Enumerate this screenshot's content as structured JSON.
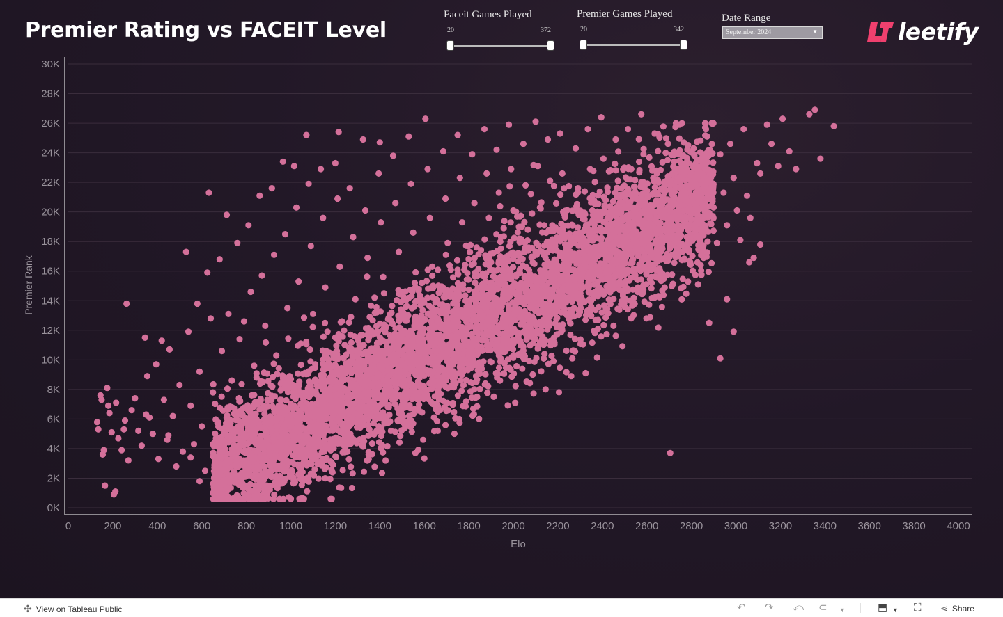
{
  "title": "Premier Rating vs FACEIT Level",
  "filters": {
    "faceit": {
      "label": "Faceit Games Played",
      "min": "20",
      "max": "372",
      "low": 0,
      "high": 1
    },
    "premier": {
      "label": "Premier Games Played",
      "min": "20",
      "max": "342",
      "low": 0,
      "high": 1
    },
    "date": {
      "label": "Date Range",
      "value": "September 2024"
    }
  },
  "logo_text": "leetify",
  "colors": {
    "point": "#d4709a",
    "grid": "#3a2d3c",
    "axis": "#ffffff",
    "tick": "#9a939c"
  },
  "footer": {
    "view_link": "View on Tableau Public",
    "share": "Share",
    "icons": [
      "tableau-icon",
      "undo-icon",
      "redo-icon",
      "revert-icon",
      "refresh-icon",
      "pause-icon",
      "download-icon",
      "fullscreen-icon",
      "share-icon"
    ]
  },
  "chart_data": {
    "type": "scatter",
    "xlabel": "Elo",
    "ylabel": "Premier Rank",
    "xlim": [
      0,
      4000
    ],
    "ylim": [
      0,
      30000
    ],
    "x_ticks": [
      "0",
      "200",
      "400",
      "600",
      "800",
      "1000",
      "1200",
      "1400",
      "1600",
      "1800",
      "2000",
      "2200",
      "2400",
      "2600",
      "2800",
      "3000",
      "3200",
      "3400",
      "3600",
      "3800",
      "4000"
    ],
    "y_ticks": [
      "0K",
      "2K",
      "4K",
      "6K",
      "8K",
      "10K",
      "12K",
      "14K",
      "16K",
      "18K",
      "20K",
      "22K",
      "24K",
      "26K",
      "28K",
      "30K"
    ],
    "grid": true,
    "points_note_color": "#d4709a",
    "points": [
      [
        130,
        5800
      ],
      [
        135,
        5300
      ],
      [
        145,
        7600
      ],
      [
        150,
        7300
      ],
      [
        155,
        3600
      ],
      [
        165,
        1500
      ],
      [
        175,
        8100
      ],
      [
        185,
        6400
      ],
      [
        195,
        5100
      ],
      [
        205,
        900
      ],
      [
        212,
        1100
      ],
      [
        215,
        7100
      ],
      [
        225,
        4700
      ],
      [
        240,
        3900
      ],
      [
        255,
        5900
      ],
      [
        262,
        13800
      ],
      [
        270,
        3200
      ],
      [
        285,
        6600
      ],
      [
        300,
        7400
      ],
      [
        315,
        5200
      ],
      [
        330,
        4200
      ],
      [
        345,
        11500
      ],
      [
        355,
        8900
      ],
      [
        365,
        6100
      ],
      [
        380,
        5000
      ],
      [
        395,
        9700
      ],
      [
        405,
        3300
      ],
      [
        420,
        11300
      ],
      [
        430,
        7300
      ],
      [
        445,
        4600
      ],
      [
        455,
        10700
      ],
      [
        470,
        6200
      ],
      [
        485,
        2800
      ],
      [
        500,
        8300
      ],
      [
        515,
        3800
      ],
      [
        530,
        17300
      ],
      [
        540,
        11900
      ],
      [
        550,
        6900
      ],
      [
        565,
        4300
      ],
      [
        580,
        13800
      ],
      [
        590,
        9200
      ],
      [
        600,
        5500
      ],
      [
        615,
        2500
      ],
      [
        625,
        15900
      ],
      [
        632,
        21300
      ],
      [
        640,
        12800
      ],
      [
        650,
        7800
      ],
      [
        665,
        3100
      ],
      [
        680,
        16800
      ],
      [
        690,
        10600
      ],
      [
        700,
        1600
      ],
      [
        712,
        19800
      ],
      [
        720,
        13100
      ],
      [
        735,
        8600
      ],
      [
        745,
        4100
      ],
      [
        760,
        17900
      ],
      [
        770,
        11400
      ],
      [
        785,
        6700
      ],
      [
        795,
        2100
      ],
      [
        810,
        19100
      ],
      [
        820,
        14600
      ],
      [
        835,
        9600
      ],
      [
        845,
        5300
      ],
      [
        860,
        21100
      ],
      [
        870,
        15700
      ],
      [
        885,
        12300
      ],
      [
        895,
        7300
      ],
      [
        905,
        3700
      ],
      [
        915,
        21600
      ],
      [
        925,
        17100
      ],
      [
        935,
        10300
      ],
      [
        950,
        6400
      ],
      [
        960,
        2900
      ],
      [
        965,
        23400
      ],
      [
        975,
        18500
      ],
      [
        985,
        13500
      ],
      [
        995,
        8900
      ],
      [
        1005,
        4900
      ],
      [
        1015,
        23100
      ],
      [
        1025,
        20300
      ],
      [
        1035,
        15300
      ],
      [
        1045,
        11100
      ],
      [
        1055,
        6800
      ],
      [
        1065,
        3500
      ],
      [
        1080,
        21900
      ],
      [
        1090,
        17700
      ],
      [
        1100,
        13100
      ],
      [
        1110,
        9700
      ],
      [
        1120,
        5600
      ],
      [
        1135,
        22900
      ],
      [
        1145,
        19600
      ],
      [
        1155,
        14900
      ],
      [
        1165,
        11900
      ],
      [
        1175,
        7900
      ],
      [
        1190,
        4300
      ],
      [
        1200,
        23300
      ],
      [
        1210,
        20900
      ],
      [
        1220,
        16300
      ],
      [
        1230,
        12600
      ],
      [
        1245,
        9100
      ],
      [
        1255,
        5900
      ],
      [
        1265,
        21600
      ],
      [
        1280,
        18300
      ],
      [
        1290,
        14100
      ],
      [
        1300,
        10500
      ],
      [
        1315,
        7100
      ],
      [
        1325,
        24900
      ],
      [
        1335,
        20100
      ],
      [
        1345,
        16900
      ],
      [
        1355,
        12900
      ],
      [
        1370,
        9600
      ],
      [
        1380,
        6100
      ],
      [
        1395,
        22600
      ],
      [
        1405,
        19300
      ],
      [
        1415,
        15600
      ],
      [
        1425,
        12100
      ],
      [
        1440,
        8900
      ],
      [
        1450,
        5200
      ],
      [
        1460,
        23800
      ],
      [
        1470,
        20600
      ],
      [
        1485,
        17300
      ],
      [
        1495,
        13900
      ],
      [
        1505,
        10400
      ],
      [
        1515,
        7300
      ],
      [
        1530,
        25100
      ],
      [
        1540,
        21900
      ],
      [
        1550,
        18600
      ],
      [
        1560,
        14900
      ],
      [
        1575,
        11300
      ],
      [
        1585,
        8100
      ],
      [
        1595,
        4600
      ],
      [
        1605,
        26300
      ],
      [
        1615,
        22900
      ],
      [
        1625,
        19600
      ],
      [
        1635,
        16300
      ],
      [
        1650,
        12900
      ],
      [
        1660,
        9800
      ],
      [
        1670,
        6600
      ],
      [
        1685,
        24100
      ],
      [
        1695,
        20900
      ],
      [
        1705,
        17900
      ],
      [
        1715,
        14600
      ],
      [
        1725,
        11600
      ],
      [
        1735,
        8400
      ],
      [
        1750,
        25200
      ],
      [
        1760,
        22300
      ],
      [
        1770,
        19300
      ],
      [
        1780,
        16100
      ],
      [
        1790,
        13100
      ],
      [
        1800,
        10300
      ],
      [
        1815,
        23900
      ],
      [
        1825,
        20600
      ],
      [
        1835,
        17600
      ],
      [
        1845,
        14400
      ],
      [
        1860,
        11400
      ],
      [
        1870,
        25600
      ],
      [
        1880,
        22600
      ],
      [
        1890,
        19600
      ],
      [
        1900,
        16600
      ],
      [
        1910,
        13600
      ],
      [
        1925,
        24200
      ],
      [
        1935,
        21300
      ],
      [
        1945,
        18300
      ],
      [
        1955,
        15300
      ],
      [
        1965,
        12400
      ],
      [
        1980,
        25900
      ],
      [
        1990,
        22900
      ],
      [
        2000,
        20100
      ],
      [
        2010,
        17100
      ],
      [
        2020,
        14100
      ],
      [
        2035,
        11100
      ],
      [
        2045,
        24600
      ],
      [
        2055,
        21800
      ],
      [
        2065,
        18800
      ],
      [
        2075,
        15800
      ],
      [
        2090,
        12800
      ],
      [
        2100,
        26100
      ],
      [
        2110,
        23100
      ],
      [
        2120,
        20300
      ],
      [
        2130,
        17300
      ],
      [
        2145,
        14300
      ],
      [
        2155,
        24900
      ],
      [
        2165,
        22100
      ],
      [
        2175,
        19100
      ],
      [
        2185,
        16300
      ],
      [
        2200,
        13300
      ],
      [
        2210,
        25300
      ],
      [
        2220,
        22600
      ],
      [
        2230,
        19800
      ],
      [
        2240,
        16800
      ],
      [
        2255,
        14600
      ],
      [
        2265,
        10100
      ],
      [
        2280,
        24300
      ],
      [
        2290,
        21600
      ],
      [
        2300,
        18600
      ],
      [
        2310,
        15800
      ],
      [
        2325,
        9100
      ],
      [
        2335,
        25600
      ],
      [
        2345,
        22900
      ],
      [
        2355,
        20100
      ],
      [
        2370,
        17300
      ],
      [
        2380,
        14300
      ],
      [
        2395,
        26400
      ],
      [
        2405,
        23600
      ],
      [
        2415,
        20800
      ],
      [
        2425,
        18100
      ],
      [
        2435,
        15300
      ],
      [
        2450,
        12300
      ],
      [
        2460,
        24900
      ],
      [
        2470,
        22100
      ],
      [
        2480,
        19300
      ],
      [
        2495,
        16600
      ],
      [
        2505,
        14100
      ],
      [
        2515,
        25600
      ],
      [
        2530,
        22900
      ],
      [
        2540,
        20300
      ],
      [
        2550,
        17600
      ],
      [
        2560,
        14900
      ],
      [
        2575,
        26600
      ],
      [
        2585,
        23900
      ],
      [
        2595,
        21300
      ],
      [
        2610,
        18600
      ],
      [
        2620,
        16100
      ],
      [
        2635,
        25300
      ],
      [
        2645,
        22600
      ],
      [
        2655,
        20100
      ],
      [
        2670,
        17500
      ],
      [
        2680,
        14900
      ],
      [
        2695,
        24600
      ],
      [
        2705,
        22100
      ],
      [
        2720,
        19600
      ],
      [
        2730,
        17100
      ],
      [
        2745,
        25900
      ],
      [
        2755,
        23300
      ],
      [
        2770,
        20800
      ],
      [
        2780,
        18300
      ],
      [
        2795,
        16600
      ],
      [
        2810,
        24300
      ],
      [
        2825,
        21800
      ],
      [
        2840,
        19300
      ],
      [
        2855,
        16900
      ],
      [
        2870,
        25100
      ],
      [
        2885,
        22600
      ],
      [
        2900,
        20300
      ],
      [
        2915,
        17900
      ],
      [
        2930,
        23900
      ],
      [
        2945,
        21300
      ],
      [
        2960,
        19100
      ],
      [
        2975,
        24600
      ],
      [
        2990,
        22300
      ],
      [
        3005,
        20100
      ],
      [
        3020,
        18100
      ],
      [
        3035,
        25600
      ],
      [
        3050,
        21100
      ],
      [
        3065,
        19600
      ],
      [
        3080,
        16900
      ],
      [
        3095,
        23300
      ],
      [
        3110,
        22600
      ],
      [
        3140,
        25900
      ],
      [
        3160,
        24600
      ],
      [
        3190,
        23100
      ],
      [
        3210,
        26300
      ],
      [
        3240,
        24100
      ],
      [
        3270,
        22900
      ],
      [
        3330,
        26600
      ],
      [
        3355,
        26900
      ],
      [
        3380,
        23600
      ],
      [
        3440,
        25800
      ],
      [
        2930,
        10100
      ],
      [
        2880,
        12500
      ],
      [
        2990,
        11900
      ],
      [
        2705,
        3700
      ],
      [
        1070,
        25200
      ],
      [
        1215,
        25400
      ],
      [
        1400,
        24700
      ],
      [
        790,
        12600
      ],
      [
        1090,
        2300
      ],
      [
        1190,
        2900
      ],
      [
        660,
        1100
      ],
      [
        590,
        1800
      ],
      [
        1560,
        3700
      ],
      [
        1660,
        5200
      ],
      [
        1820,
        6700
      ],
      [
        1940,
        8600
      ],
      [
        2040,
        9400
      ],
      [
        2140,
        10400
      ],
      [
        2260,
        8900
      ],
      [
        2380,
        12100
      ],
      [
        2500,
        13600
      ],
      [
        2620,
        15600
      ],
      [
        2710,
        17100
      ],
      [
        2830,
        15100
      ],
      [
        2960,
        14100
      ],
      [
        3060,
        16600
      ],
      [
        3110,
        17800
      ],
      [
        1480,
        5900
      ],
      [
        1350,
        3600
      ],
      [
        1250,
        4900
      ],
      [
        1150,
        3300
      ],
      [
        1050,
        3900
      ],
      [
        950,
        2600
      ],
      [
        850,
        3800
      ],
      [
        750,
        2900
      ],
      [
        650,
        4300
      ],
      [
        550,
        3400
      ],
      [
        450,
        4900
      ],
      [
        350,
        6300
      ],
      [
        250,
        5300
      ],
      [
        180,
        6900
      ],
      [
        160,
        3900
      ]
    ]
  }
}
